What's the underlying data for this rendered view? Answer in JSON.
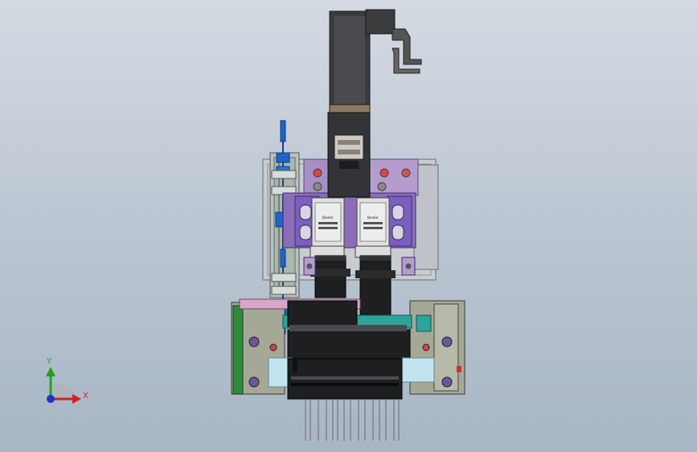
{
  "app": {
    "view_type": "3D CAD assembly viewport",
    "background_top": "#d4dae2",
    "background_bottom": "#a8b6c5"
  },
  "triad": {
    "y_label": "Y",
    "x_label": "X",
    "y_color": "#1fa31f",
    "x_color": "#d42020",
    "z_color": "#2030d0"
  },
  "labels": {
    "camera_left_text": "Basler",
    "camera_right_text": "Basler"
  },
  "colors": {
    "motor": "#3a3b3d",
    "plate_lilac": "#a58fc4",
    "plate_purple": "#8a6fb8",
    "plate_violet": "#7a5ec0",
    "plate_grey": "#c9ccd1",
    "plate_olive": "#a5a896",
    "plate_teal": "#2da39a",
    "plate_pink": "#d8a8c8",
    "plate_green": "#2e8b3a",
    "cylinder_black": "#1e1f21",
    "sensor_blue": "#1f64c8"
  }
}
